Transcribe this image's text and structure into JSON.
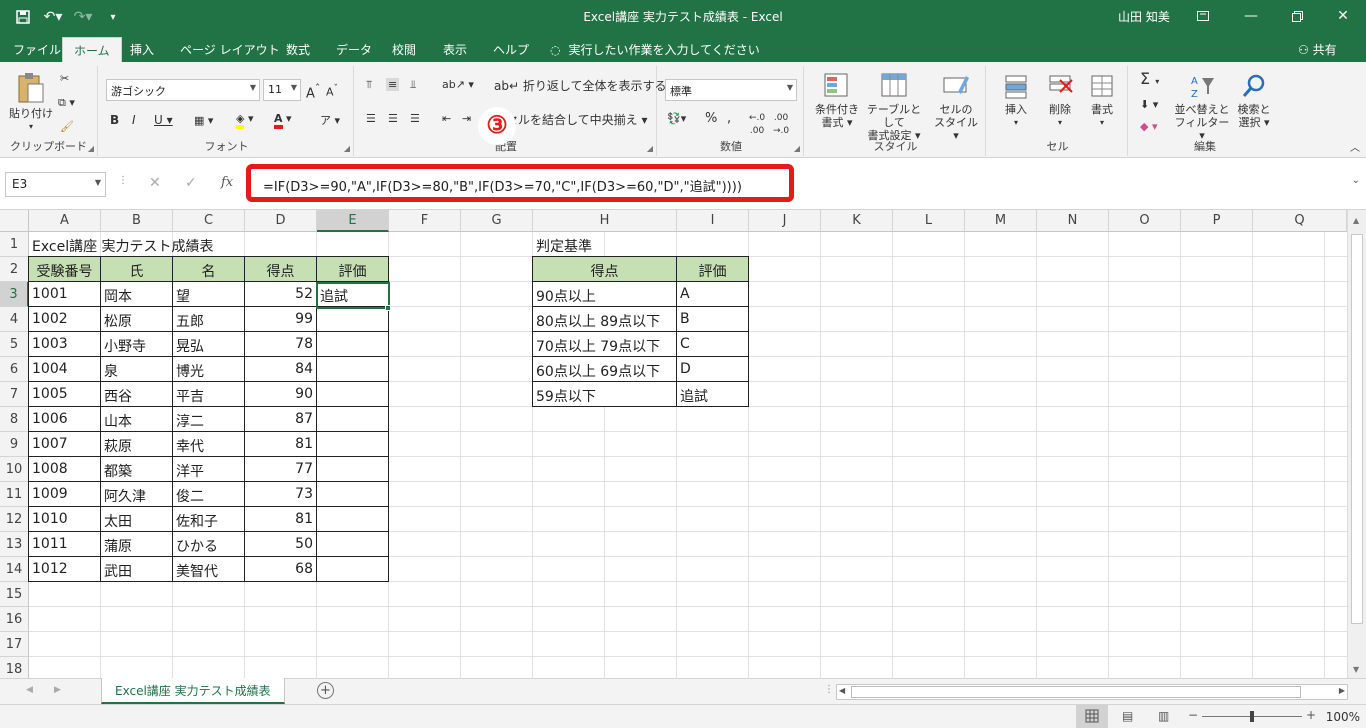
{
  "app": {
    "title": "Excel講座 実力テスト成績表  -  Excel",
    "user": "山田 知美"
  },
  "tabs": [
    "ファイル",
    "ホーム",
    "挿入",
    "ページ レイアウト",
    "数式",
    "データ",
    "校閲",
    "表示",
    "ヘルプ"
  ],
  "tell_me": "実行したい作業を入力してください",
  "share": "共有",
  "ribbon": {
    "clipboard": {
      "label": "クリップボード",
      "paste": "貼り付け"
    },
    "font": {
      "label": "フォント",
      "name": "游ゴシック",
      "size": "11"
    },
    "alignment": {
      "label": "配置",
      "wrap": "折り返して全体を表示する",
      "merge": "セルを結合して中央揃え"
    },
    "number": {
      "label": "数値",
      "format": "標準"
    },
    "styles": {
      "label": "スタイル",
      "conditional": "条件付き",
      "conditional2": "書式",
      "table": "テーブルとして",
      "table2": "書式設定",
      "cell": "セルの",
      "cell2": "スタイル"
    },
    "cells": {
      "label": "セル",
      "insert": "挿入",
      "delete": "削除",
      "format": "書式"
    },
    "editing": {
      "label": "編集",
      "sort": "並べ替えと",
      "sort2": "フィルター",
      "find": "検索と",
      "find2": "選択"
    }
  },
  "annotation": "③",
  "name_box": "E3",
  "formula": "=IF(D3>=90,\"A\",IF(D3>=80,\"B\",IF(D3>=70,\"C\",IF(D3>=60,\"D\",\"追試\"))))",
  "columns": [
    "A",
    "B",
    "C",
    "D",
    "E",
    "F",
    "G",
    "H",
    "I",
    "J",
    "K",
    "L",
    "M",
    "N",
    "O",
    "P",
    "Q"
  ],
  "rows": [
    "1",
    "2",
    "3",
    "4",
    "5",
    "6",
    "7",
    "8",
    "9",
    "10",
    "11",
    "12",
    "13",
    "14",
    "15",
    "16",
    "17",
    "18"
  ],
  "sheet_title": "Excel講座 実力テスト成績表",
  "table_headers": [
    "受験番号",
    "氏",
    "名",
    "得点",
    "評価"
  ],
  "students": [
    [
      "1001",
      "岡本",
      "望",
      "52",
      "追試"
    ],
    [
      "1002",
      "松原",
      "五郎",
      "99",
      ""
    ],
    [
      "1003",
      "小野寺",
      "晃弘",
      "78",
      ""
    ],
    [
      "1004",
      "泉",
      "博光",
      "84",
      ""
    ],
    [
      "1005",
      "西谷",
      "平吉",
      "90",
      ""
    ],
    [
      "1006",
      "山本",
      "淳二",
      "87",
      ""
    ],
    [
      "1007",
      "萩原",
      "幸代",
      "81",
      ""
    ],
    [
      "1008",
      "都築",
      "洋平",
      "77",
      ""
    ],
    [
      "1009",
      "阿久津",
      "俊二",
      "73",
      ""
    ],
    [
      "1010",
      "太田",
      "佐和子",
      "81",
      ""
    ],
    [
      "1011",
      "蒲原",
      "ひかる",
      "50",
      ""
    ],
    [
      "1012",
      "武田",
      "美智代",
      "68",
      ""
    ]
  ],
  "criteria_title": "判定基準",
  "criteria_headers": [
    "得点",
    "評価"
  ],
  "criteria": [
    [
      "90点以上",
      "A"
    ],
    [
      "80点以上 89点以下",
      "B"
    ],
    [
      "70点以上 79点以下",
      "C"
    ],
    [
      "60点以上 69点以下",
      "D"
    ],
    [
      "59点以下",
      "追試"
    ]
  ],
  "sheet_tab": "Excel講座 実力テスト成績表",
  "zoom": "100%",
  "colors": {
    "excel_green": "#217346",
    "header_fill": "#c6e0b4",
    "highlight": "#e31b1b"
  }
}
